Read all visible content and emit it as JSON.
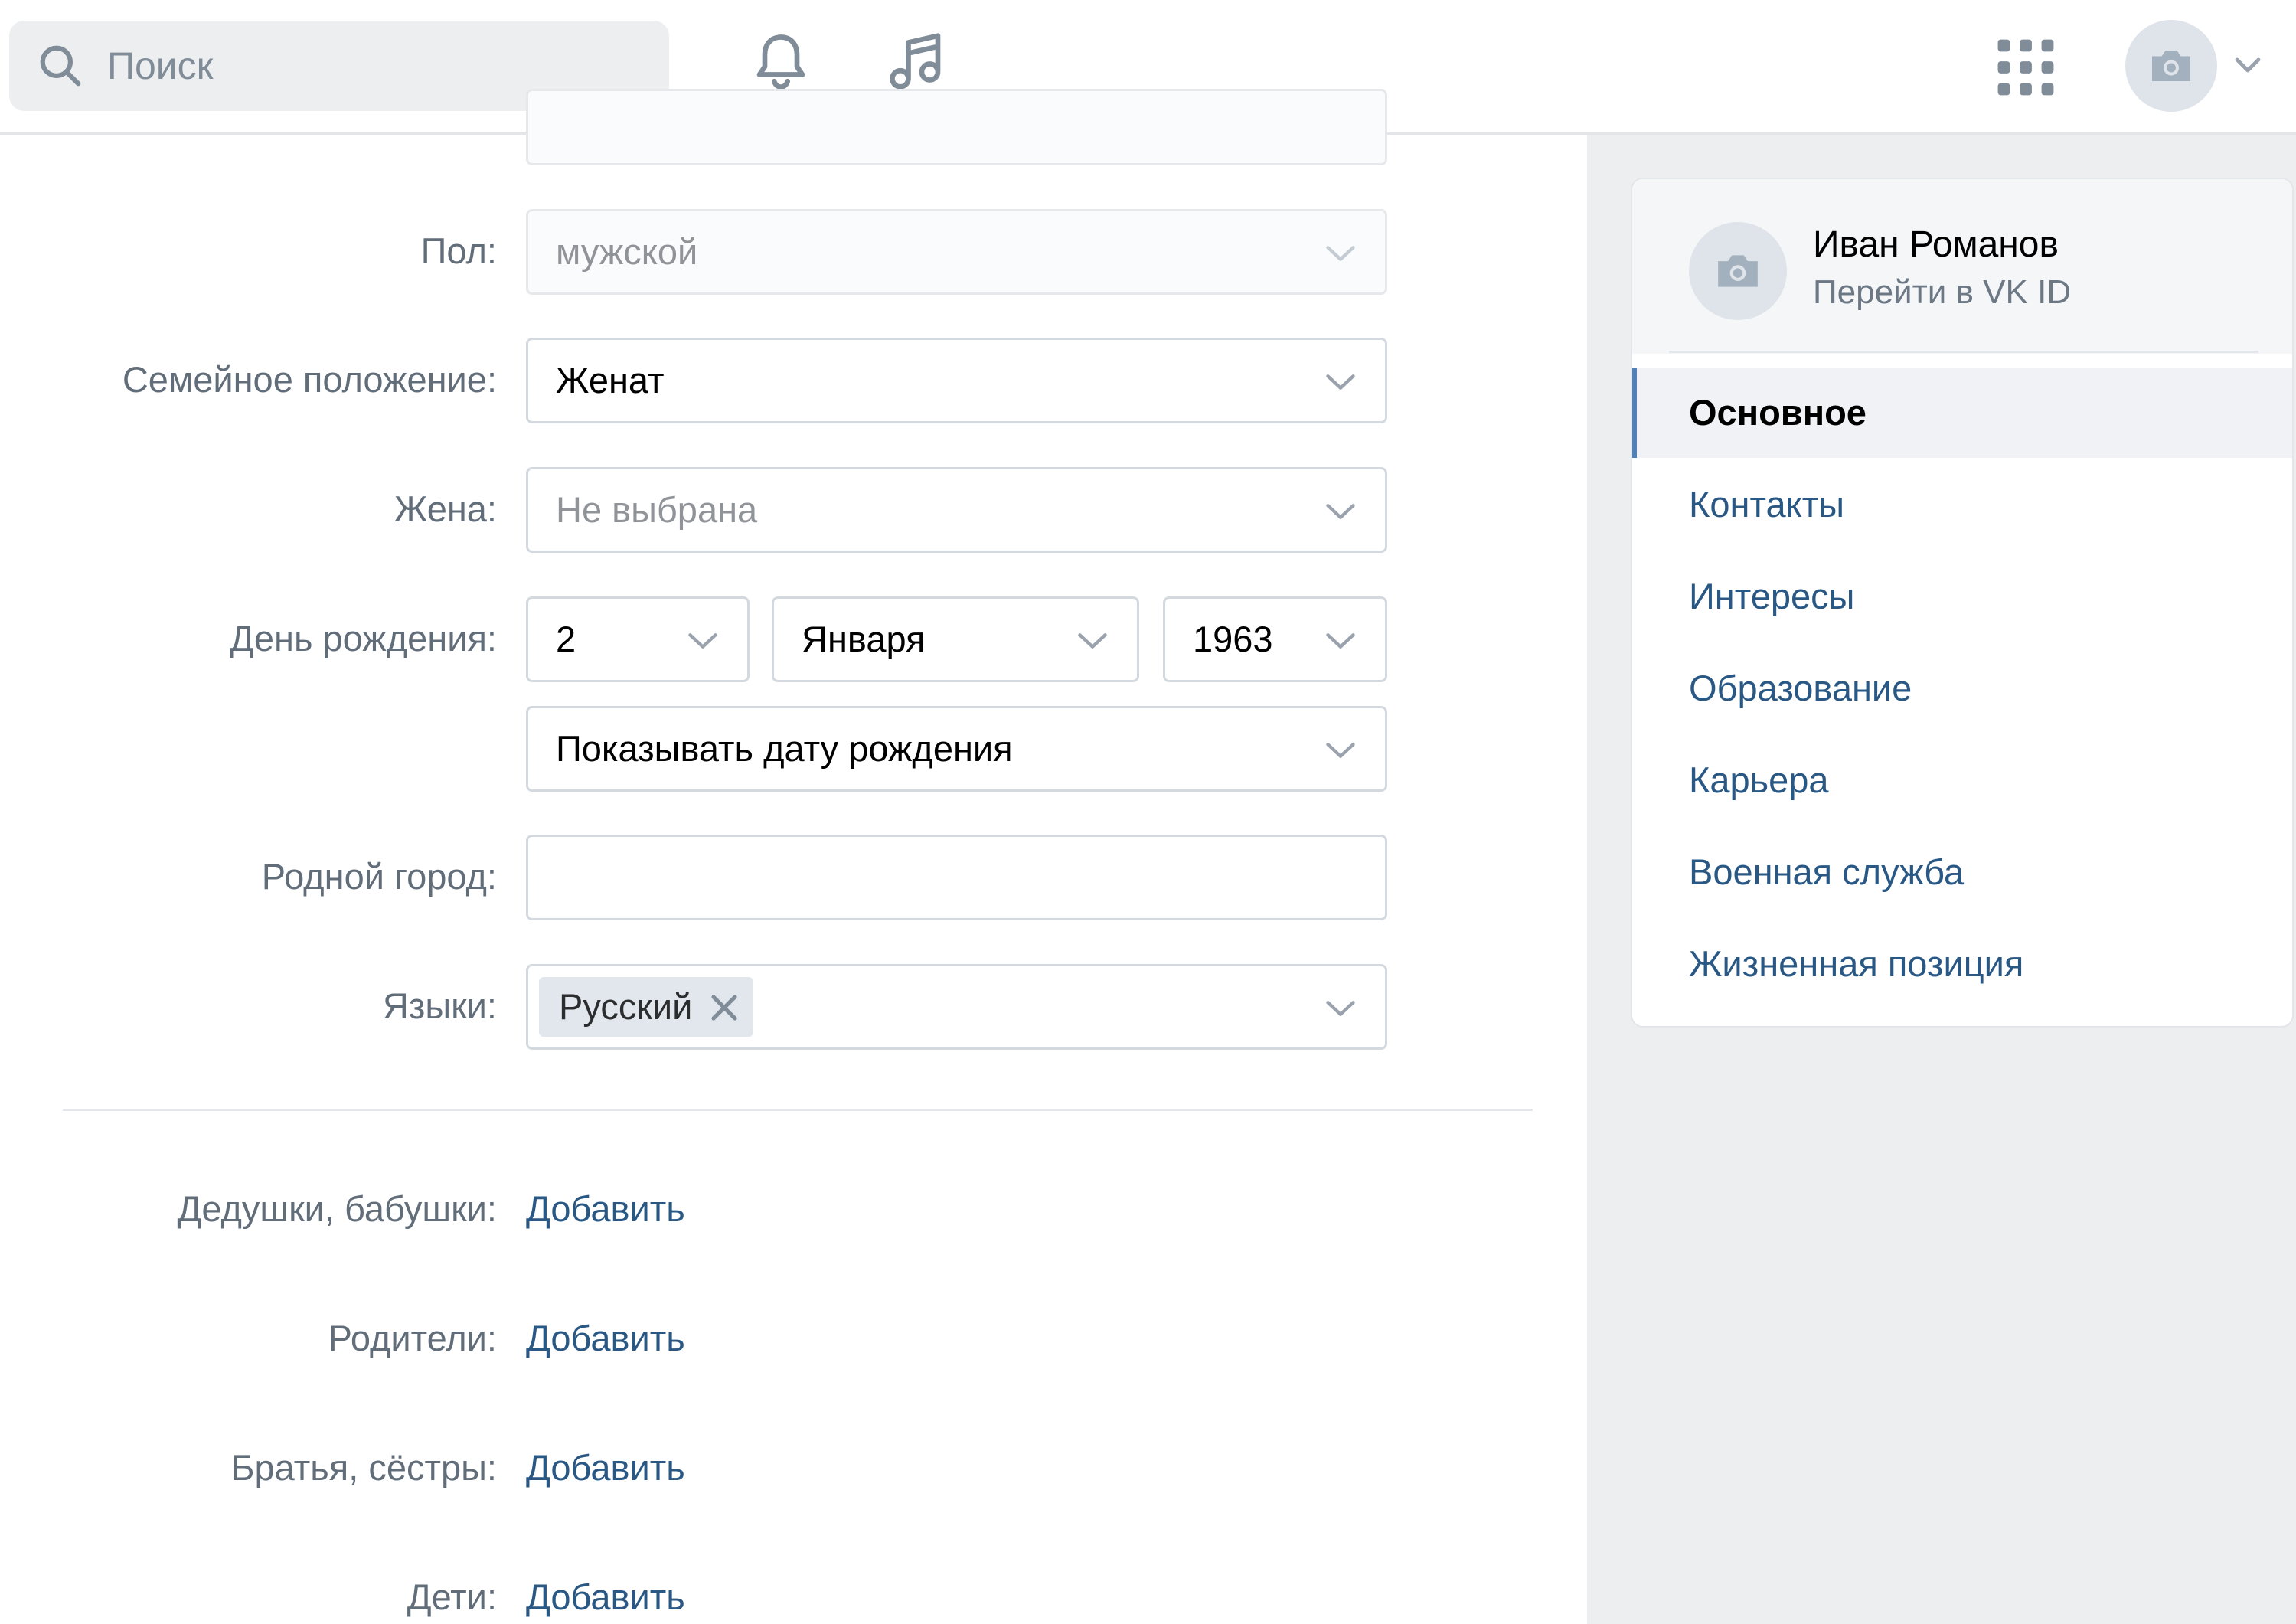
{
  "topbar": {
    "search_placeholder": "Поиск"
  },
  "profile_card": {
    "name": "Иван Романов",
    "subtitle": "Перейти в VK ID"
  },
  "menu": {
    "items": [
      {
        "label": "Основное",
        "active": true
      },
      {
        "label": "Контакты"
      },
      {
        "label": "Интересы"
      },
      {
        "label": "Образование"
      },
      {
        "label": "Карьера"
      },
      {
        "label": "Военная служба"
      },
      {
        "label": "Жизненная позиция"
      }
    ]
  },
  "form": {
    "gender": {
      "label": "Пол:",
      "value": "мужской"
    },
    "marital": {
      "label": "Семейное положение:",
      "value": "Женат"
    },
    "wife": {
      "label": "Жена:",
      "value": "Не выбрана"
    },
    "birthday": {
      "label": "День рождения:",
      "day": "2",
      "month": "Января",
      "year": "1963",
      "visibility": "Показывать дату рождения"
    },
    "hometown": {
      "label": "Родной город:",
      "value": ""
    },
    "languages": {
      "label": "Языки:",
      "tags": [
        "Русский"
      ]
    },
    "relatives": [
      {
        "label": "Дедушки, бабушки:",
        "action": "Добавить"
      },
      {
        "label": "Родители:",
        "action": "Добавить"
      },
      {
        "label": "Братья, сёстры:",
        "action": "Добавить"
      },
      {
        "label": "Дети:",
        "action": "Добавить"
      }
    ]
  },
  "colors": {
    "accent": "#2a5885",
    "active_marker": "#5181b8",
    "page_bg": "#edeef0",
    "border": "#d3d9de"
  },
  "icons": [
    "search-icon",
    "bell-icon",
    "music-icon",
    "apps-grid-icon",
    "camera-icon",
    "chevron-down-icon",
    "close-icon"
  ]
}
